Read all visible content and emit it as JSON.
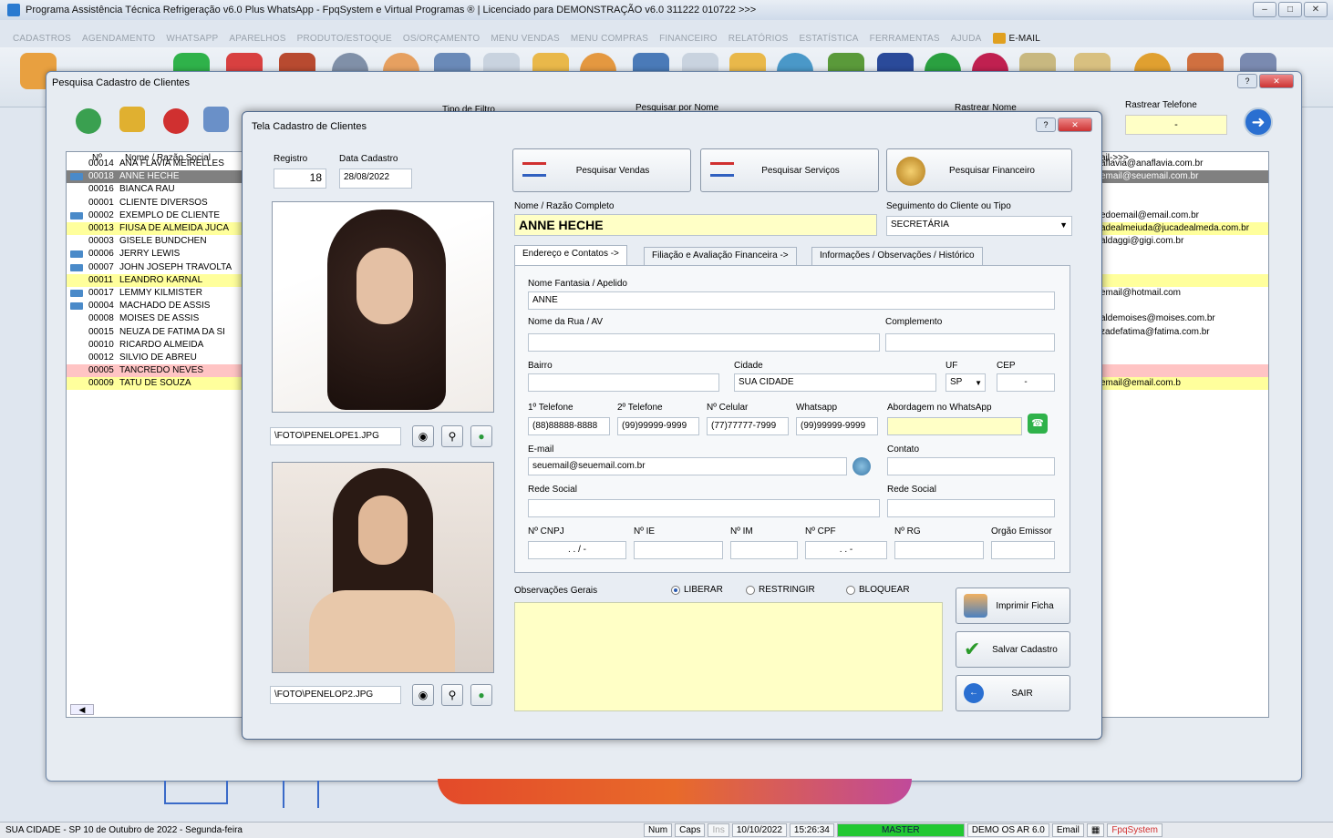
{
  "window_title": "Programa Assistência Técnica Refrigeração v6.0 Plus WhatsApp - FpqSystem e Virtual Programas ® | Licenciado para  DEMONSTRAÇÃO v6.0 311222 010722 >>>",
  "menu": [
    "CADASTROS",
    "AGENDAMENTO",
    "WHATSAPP",
    "APARELHOS",
    "PRODUTO/ESTOQUE",
    "OS/ORÇAMENTO",
    "MENU VENDAS",
    "MENU COMPRAS",
    "FINANCEIRO",
    "RELATÓRIOS",
    "ESTATÍSTICA",
    "FERRAMENTAS",
    "AJUDA"
  ],
  "menu_email": "E-MAIL",
  "search_window": {
    "title": "Pesquisa Cadastro de Clientes",
    "col_num": "Nº",
    "col_name": "Nome / Razão Social",
    "filter_label": "Tipo de Filtro",
    "search_name_label": "Pesquisar por Nome",
    "track_name_label": "Rastrear Nome",
    "track_phone_label": "Rastrear Telefone",
    "track_phone_value": "-",
    "email_col": "ail->>>",
    "rows": [
      {
        "num": "00014",
        "name": "ANA FLAVIA MEIRELLES",
        "email": "aflavia@anaflavia.com.br",
        "style": "",
        "icon": false
      },
      {
        "num": "00018",
        "name": "ANNE HECHE",
        "email": "email@seuemail.com.br",
        "style": "sel",
        "icon": true
      },
      {
        "num": "00016",
        "name": "BIANCA RAU",
        "email": "",
        "style": "",
        "icon": false
      },
      {
        "num": "00001",
        "name": "CLIENTE DIVERSOS",
        "email": "",
        "style": "",
        "icon": false
      },
      {
        "num": "00002",
        "name": "EXEMPLO DE CLIENTE",
        "email": "edoemail@email.com.br",
        "style": "",
        "icon": true
      },
      {
        "num": "00013",
        "name": "FIUSA DE ALMEIDA JUCA",
        "email": "adealmeiuda@jucadealmeda.com.br",
        "style": "yel",
        "icon": false
      },
      {
        "num": "00003",
        "name": "GISELE BUNDCHEN",
        "email": "aldaggi@gigi.com.br",
        "style": "",
        "icon": false
      },
      {
        "num": "00006",
        "name": "JERRY LEWIS",
        "email": "",
        "style": "",
        "icon": true
      },
      {
        "num": "00007",
        "name": "JOHN JOSEPH TRAVOLTA",
        "email": "",
        "style": "",
        "icon": true
      },
      {
        "num": "00011",
        "name": "LEANDRO KARNAL",
        "email": "",
        "style": "yel",
        "icon": false
      },
      {
        "num": "00017",
        "name": "LEMMY KILMISTER",
        "email": "email@hotmail.com",
        "style": "",
        "icon": true
      },
      {
        "num": "00004",
        "name": "MACHADO DE ASSIS",
        "email": "",
        "style": "",
        "icon": true
      },
      {
        "num": "00008",
        "name": "MOISES DE ASSIS",
        "email": "aldemoises@moises.com.br",
        "style": "",
        "icon": false
      },
      {
        "num": "00015",
        "name": "NEUZA DE FATIMA DA SI",
        "email": "zadefatima@fatima.com.br",
        "style": "",
        "icon": false
      },
      {
        "num": "00010",
        "name": "RICARDO ALMEIDA",
        "email": "",
        "style": "",
        "icon": false
      },
      {
        "num": "00012",
        "name": "SILVIO DE ABREU",
        "email": "",
        "style": "",
        "icon": false
      },
      {
        "num": "00005",
        "name": "TANCREDO NEVES",
        "email": "",
        "style": "pink",
        "icon": false
      },
      {
        "num": "00009",
        "name": "TATU DE SOUZA",
        "email": "email@email.com.b",
        "style": "yel",
        "icon": false
      }
    ]
  },
  "dialog": {
    "title": "Tela Cadastro de Clientes",
    "registro_label": "Registro",
    "registro": "18",
    "data_label": "Data Cadastro",
    "data": "28/08/2022",
    "photo1_path": "\\FOTO\\PENELOPE1.JPG",
    "photo2_path": "\\FOTO\\PENELOP2.JPG",
    "btn_vendas": "Pesquisar Vendas",
    "btn_servicos": "Pesquisar Serviços",
    "btn_financeiro": "Pesquisar Financeiro",
    "nome_label": "Nome / Razão Completo",
    "nome": "ANNE HECHE",
    "segmento_label": "Seguimento do Cliente ou Tipo",
    "segmento": "SECRETÁRIA",
    "tabs": [
      "Endereço e Contatos ->",
      "Filiação e Avaliação Financeira ->",
      "Informações / Observações / Histórico"
    ],
    "fantasia_label": "Nome Fantasia / Apelido",
    "fantasia": "ANNE",
    "rua_label": "Nome da Rua / AV",
    "complemento_label": "Complemento",
    "bairro_label": "Bairro",
    "cidade_label": "Cidade",
    "cidade": "SUA CIDADE",
    "uf_label": "UF",
    "uf": "SP",
    "cep_label": "CEP",
    "cep": "-",
    "tel1_label": "1º Telefone",
    "tel1": "(88)88888-8888",
    "tel2_label": "2º Telefone",
    "tel2": "(99)99999-9999",
    "cel_label": "Nº Celular",
    "cel": "(77)77777-7999",
    "whats_label": "Whatsapp",
    "whats": "(99)99999-9999",
    "abordagem_label": "Abordagem no WhatsApp",
    "email_label": "E-mail",
    "email": "seuemail@seuemail.com.br",
    "contato_label": "Contato",
    "rede1_label": "Rede Social",
    "rede2_label": "Rede Social",
    "cnpj_label": "Nº CNPJ",
    "cnpj": ". . / -",
    "ie_label": "Nº IE",
    "im_label": "Nº IM",
    "cpf_label": "Nº CPF",
    "cpf": ". . -",
    "rg_label": "Nº RG",
    "orgao_label": "Orgão Emissor",
    "obs_label": "Observações Gerais",
    "radio": [
      "LIBERAR",
      "RESTRINGIR",
      "BLOQUEAR"
    ],
    "btn_imprimir": "Imprimir Ficha",
    "btn_salvar": "Salvar Cadastro",
    "btn_sair": "SAIR"
  },
  "status": {
    "left": "SUA CIDADE - SP 10 de Outubro de 2022 - Segunda-feira",
    "num": "Num",
    "caps": "Caps",
    "ins": "Ins",
    "date": "10/10/2022",
    "time": "15:26:34",
    "master": "MASTER",
    "demo": "DEMO OS AR 6.0",
    "email": "Email",
    "fpq": "FpqSystem"
  }
}
